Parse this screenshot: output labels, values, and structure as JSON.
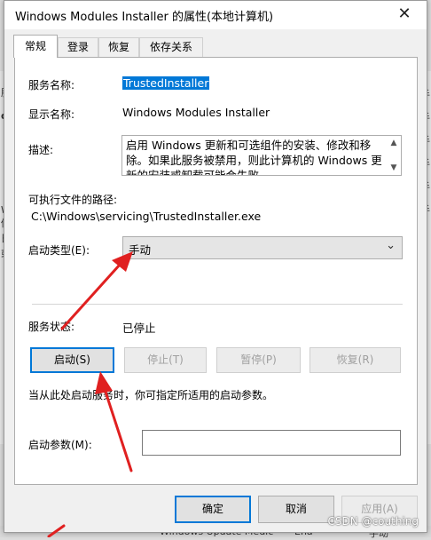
{
  "window": {
    "title": "Windows Modules Installer 的属性(本地计算机)",
    "close_label": "✕"
  },
  "tabs": [
    {
      "label": "常规"
    },
    {
      "label": "登录"
    },
    {
      "label": "恢复"
    },
    {
      "label": "依存关系"
    }
  ],
  "general": {
    "service_name_label": "服务名称:",
    "service_name": "TrustedInstaller",
    "display_name_label": "显示名称:",
    "display_name": "Windows Modules Installer",
    "description_label": "描述:",
    "description": "启用 Windows 更新和可选组件的安装、修改和移除。如果此服务被禁用，则此计算机的 Windows 更新的安装或卸载可能会失败",
    "exe_path_label": "可执行文件的路径:",
    "exe_path": "C:\\Windows\\servicing\\TrustedInstaller.exe",
    "startup_type_label": "启动类型(E):",
    "startup_type_value": "手动",
    "service_status_label": "服务状态:",
    "service_status_value": "已停止",
    "start_button": "启动(S)",
    "stop_button": "停止(T)",
    "pause_button": "暂停(P)",
    "resume_button": "恢复(R)",
    "hint": "当从此处启动服务时，你可指定所适用的启动参数。",
    "start_params_label": "启动参数(M):",
    "start_params_value": ""
  },
  "footer": {
    "ok_button": "确定",
    "cancel_button": "取消",
    "apply_button": "应用(A)"
  },
  "background": {
    "left_snippets": [
      "服",
      "d",
      "W",
      "修",
      "日",
      "或"
    ],
    "right_snippets": [
      "手",
      "手",
      "手",
      "手",
      "手",
      "手"
    ],
    "bottom_snippets": [
      "Windows Update Medic",
      "Ena",
      "手动"
    ]
  },
  "watermark": "CSDN @couthing",
  "colors": {
    "accent": "#0078d7",
    "annotation_arrow": "#e02020"
  }
}
